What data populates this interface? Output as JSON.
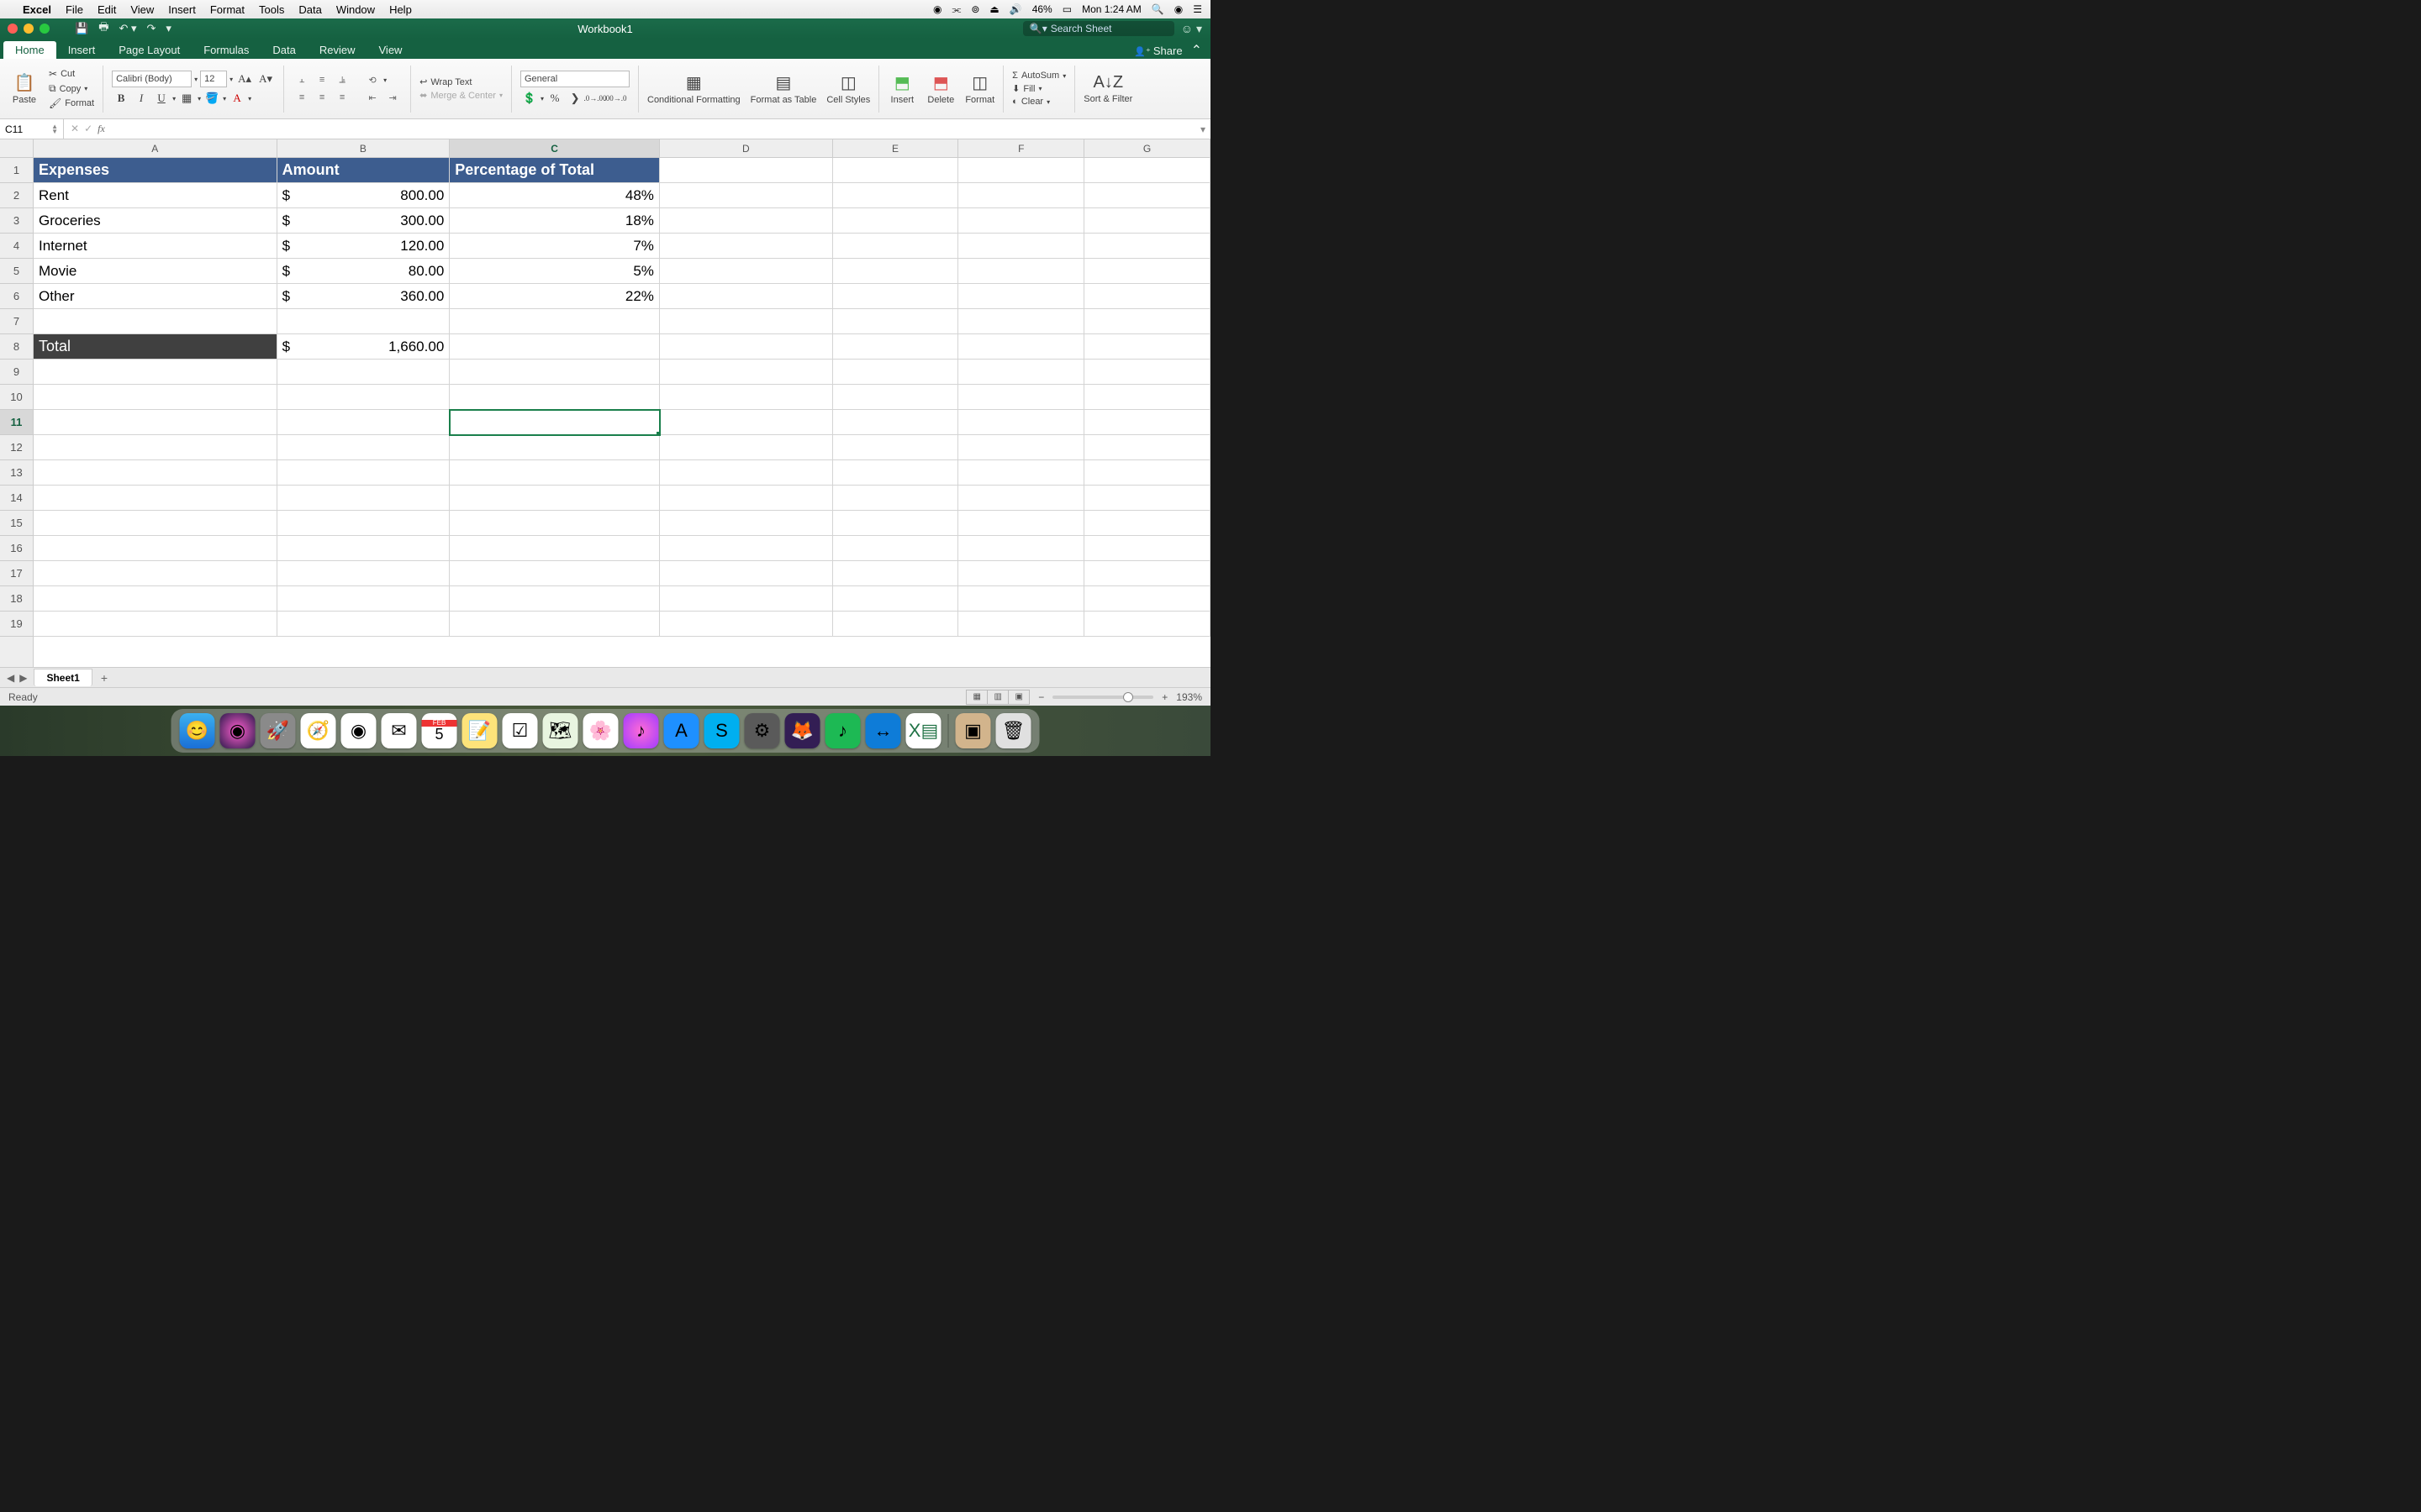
{
  "menubar": {
    "app": "Excel",
    "items": [
      "File",
      "Edit",
      "View",
      "Insert",
      "Format",
      "Tools",
      "Data",
      "Window",
      "Help"
    ],
    "battery": "46%",
    "clock": "Mon 1:24 AM"
  },
  "window": {
    "title": "Workbook1",
    "search_placeholder": "Search Sheet"
  },
  "ribbon_tabs": [
    "Home",
    "Insert",
    "Page Layout",
    "Formulas",
    "Data",
    "Review",
    "View"
  ],
  "ribbon": {
    "active_tab": "Home",
    "share": "Share",
    "paste": "Paste",
    "cut": "Cut",
    "copy": "Copy",
    "format_painter": "Format",
    "font_name": "Calibri (Body)",
    "font_size": "12",
    "wrap": "Wrap Text",
    "merge": "Merge & Center",
    "number_format": "General",
    "cond_fmt": "Conditional Formatting",
    "fmt_table": "Format as Table",
    "cell_styles": "Cell Styles",
    "insert": "Insert",
    "delete": "Delete",
    "format": "Format",
    "autosum": "AutoSum",
    "fill": "Fill",
    "clear": "Clear",
    "sort_filter": "Sort & Filter"
  },
  "formula_bar": {
    "cell_ref": "C11",
    "formula": ""
  },
  "columns": [
    "A",
    "B",
    "C",
    "D",
    "E",
    "F",
    "G"
  ],
  "rows": [
    1,
    2,
    3,
    4,
    5,
    6,
    7,
    8,
    9,
    10,
    11,
    12,
    13,
    14,
    15,
    16,
    17,
    18,
    19
  ],
  "active": {
    "row": 11,
    "col": "C"
  },
  "table": {
    "headers": [
      "Expenses",
      "Amount",
      "Percentage of Total"
    ],
    "rows": [
      {
        "label": "Rent",
        "amount": "800.00",
        "pct": "48%"
      },
      {
        "label": "Groceries",
        "amount": "300.00",
        "pct": "18%"
      },
      {
        "label": "Internet",
        "amount": "120.00",
        "pct": "7%"
      },
      {
        "label": "Movie",
        "amount": "80.00",
        "pct": "5%"
      },
      {
        "label": "Other",
        "amount": "360.00",
        "pct": "22%"
      }
    ],
    "total_label": "Total",
    "total_amount": "1,660.00",
    "currency_symbol": "$"
  },
  "sheet_tabs": {
    "active": "Sheet1"
  },
  "status": {
    "ready": "Ready",
    "zoom": "193%"
  },
  "dock": [
    "finder",
    "siri",
    "launchpad",
    "safari",
    "chrome",
    "mail",
    "cal",
    "notes",
    "reminders",
    "maps",
    "photos",
    "itunes",
    "appstore",
    "skype",
    "settings",
    "firefox",
    "spotify",
    "teamviewer",
    "excel",
    "|",
    "zip",
    "trash"
  ]
}
